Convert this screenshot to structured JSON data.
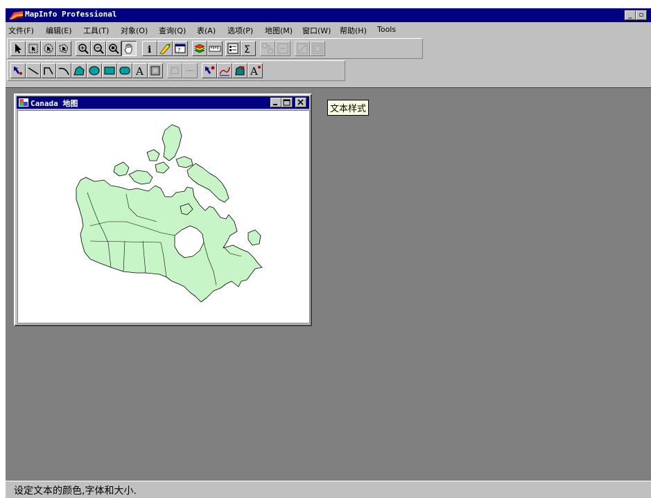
{
  "window": {
    "title": "MapInfo Professional",
    "minimize_label": "_",
    "restore_label": "▫"
  },
  "menu": [
    {
      "label": "文件(F)"
    },
    {
      "label": "编辑(E)"
    },
    {
      "label": "工具(T)"
    },
    {
      "label": "对象(O)"
    },
    {
      "label": "查询(Q)"
    },
    {
      "label": "表(A)"
    },
    {
      "label": "选项(P)"
    },
    {
      "label": "地图(M)"
    },
    {
      "label": "窗口(W)"
    },
    {
      "label": "帮助(H)"
    },
    {
      "label": "Tools"
    }
  ],
  "toolbar_main": [
    {
      "icon": "select-arrow-icon"
    },
    {
      "icon": "marquee-select-icon"
    },
    {
      "icon": "radius-select-icon"
    },
    {
      "icon": "polygon-select-icon"
    },
    {
      "icon": "zoom-in-icon"
    },
    {
      "icon": "zoom-out-icon"
    },
    {
      "icon": "change-view-icon"
    },
    {
      "icon": "grabber-hand-icon",
      "pressed": true
    },
    {
      "icon": "info-tool-icon"
    },
    {
      "icon": "label-tool-icon"
    },
    {
      "icon": "drag-window-icon"
    },
    {
      "icon": "layer-control-icon"
    },
    {
      "icon": "ruler-icon"
    },
    {
      "icon": "legend-icon"
    },
    {
      "icon": "statistics-sum-icon"
    },
    {
      "icon": "redistrict-icon"
    },
    {
      "icon": "assign-target-icon"
    },
    {
      "icon": "graph-window-icon"
    },
    {
      "icon": "layout-window-icon"
    }
  ],
  "toolbar_draw": [
    {
      "icon": "symbol-tool-icon"
    },
    {
      "icon": "line-tool-icon"
    },
    {
      "icon": "polyline-tool-icon"
    },
    {
      "icon": "arc-tool-icon"
    },
    {
      "icon": "polygon-tool-icon"
    },
    {
      "icon": "ellipse-tool-icon"
    },
    {
      "icon": "rectangle-tool-icon"
    },
    {
      "icon": "rounded-rectangle-tool-icon"
    },
    {
      "icon": "text-tool-icon",
      "text": "A"
    },
    {
      "icon": "frame-tool-icon"
    },
    {
      "icon": "reshape-tool-icon"
    },
    {
      "icon": "add-node-tool-icon"
    },
    {
      "icon": "symbol-style-icon"
    },
    {
      "icon": "line-style-icon"
    },
    {
      "icon": "region-style-icon"
    },
    {
      "icon": "text-style-icon",
      "text": "A"
    }
  ],
  "map_window": {
    "title": "Canada 地图",
    "region_fill": "#c8f5c8",
    "region_stroke": "#000000"
  },
  "tooltip": {
    "text": "文本样式"
  },
  "status": {
    "text": "设定文本的颜色,字体和大小."
  },
  "colors": {
    "title_bar": "#000080",
    "workspace": "#808080",
    "chrome": "#c0c0c0"
  }
}
